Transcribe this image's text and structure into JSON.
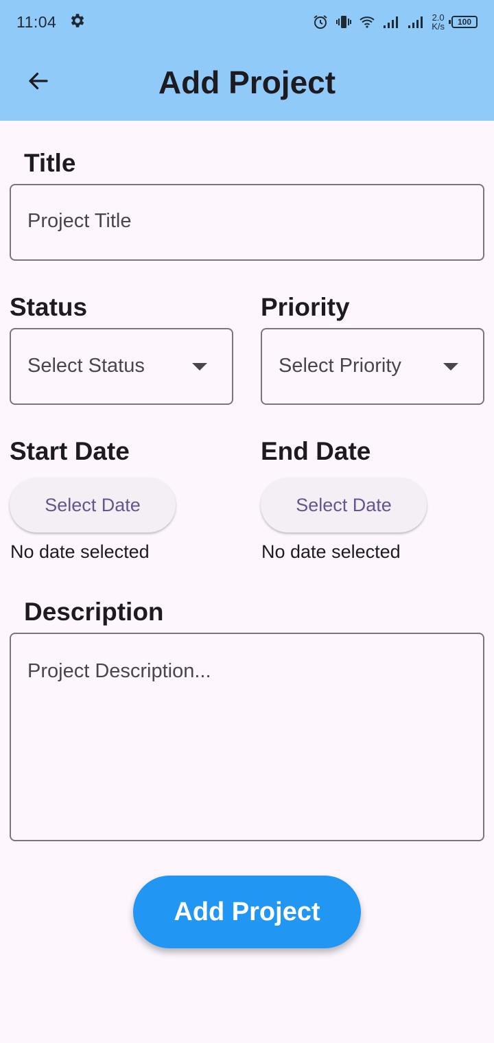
{
  "status_bar": {
    "time": "11:04",
    "net_speed_value": "2.0",
    "net_speed_unit": "K/s",
    "battery": "100",
    "icons": [
      "settings-icon",
      "alarm-icon",
      "vibrate-icon",
      "wifi-icon",
      "signal-icon",
      "signal-icon",
      "battery-icon"
    ]
  },
  "app_bar": {
    "title": "Add Project",
    "back_icon": "arrow-back-icon",
    "background": "#90caf9"
  },
  "form": {
    "title_label": "Title",
    "title_placeholder": "Project Title",
    "status_label": "Status",
    "status_placeholder": "Select Status",
    "priority_label": "Priority",
    "priority_placeholder": "Select Priority",
    "start_date_label": "Start Date",
    "start_date_button": "Select Date",
    "start_date_note": "No date selected",
    "end_date_label": "End Date",
    "end_date_button": "Select Date",
    "end_date_note": "No date selected",
    "description_label": "Description",
    "description_placeholder": "Project Description...",
    "submit_label": "Add Project",
    "accent": "#2196f3"
  }
}
